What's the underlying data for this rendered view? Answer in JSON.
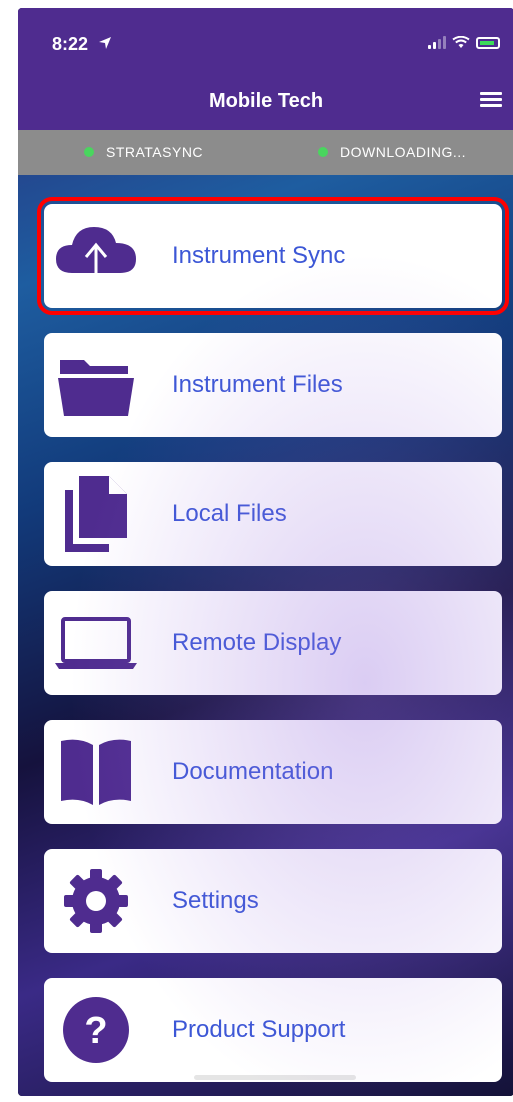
{
  "status_bar": {
    "time": "8:22"
  },
  "header": {
    "title": "Mobile Tech"
  },
  "connection": {
    "items": [
      {
        "label": "STRATASYNC",
        "status_color": "#49d65e"
      },
      {
        "label": "DOWNLOADING...",
        "status_color": "#49d65e"
      }
    ]
  },
  "colors": {
    "accent": "#4f2c8f",
    "label": "#3c57d6",
    "highlight": "#ff0000"
  },
  "menu": {
    "items": [
      {
        "label": "Instrument Sync",
        "icon": "cloud-upload-icon",
        "highlighted": true
      },
      {
        "label": "Instrument Files",
        "icon": "folder-icon"
      },
      {
        "label": "Local Files",
        "icon": "files-icon"
      },
      {
        "label": "Remote Display",
        "icon": "laptop-icon"
      },
      {
        "label": "Documentation",
        "icon": "book-icon"
      },
      {
        "label": "Settings",
        "icon": "gear-icon"
      },
      {
        "label": "Product Support",
        "icon": "help-icon"
      }
    ]
  }
}
